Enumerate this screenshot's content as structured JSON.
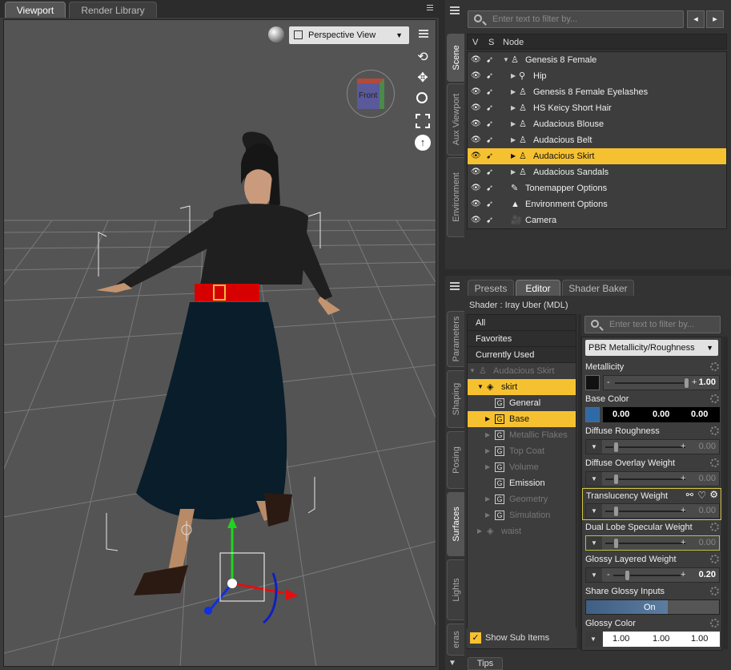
{
  "tabs": {
    "viewport": "Viewport",
    "render_library": "Render Library"
  },
  "viewport": {
    "camera": "Perspective View",
    "cube_label": "Front"
  },
  "scene": {
    "filter_placeholder": "Enter text to filter by...",
    "col_v": "V",
    "col_s": "S",
    "col_node": "Node",
    "nodes": [
      {
        "label": "Genesis 8 Female"
      },
      {
        "label": "Hip"
      },
      {
        "label": "Genesis 8 Female Eyelashes"
      },
      {
        "label": "HS Keicy Short Hair"
      },
      {
        "label": "Audacious Blouse"
      },
      {
        "label": "Audacious Belt"
      },
      {
        "label": "Audacious Skirt"
      },
      {
        "label": "Audacious Sandals"
      },
      {
        "label": "Tonemapper Options"
      },
      {
        "label": "Environment Options"
      },
      {
        "label": "Camera"
      }
    ]
  },
  "side_tabs_top": {
    "scene": "Scene",
    "aux": "Aux Viewport",
    "env": "Environment"
  },
  "side_tabs_bottom": {
    "parameters": "Parameters",
    "shaping": "Shaping",
    "posing": "Posing",
    "surfaces": "Surfaces",
    "lights": "Lights",
    "cameras": "eras"
  },
  "surfaces": {
    "tab_presets": "Presets",
    "tab_editor": "Editor",
    "tab_shader": "Shader Baker",
    "shader": "Shader : Iray Uber (MDL)",
    "filter_placeholder": "Enter text to filter by...",
    "mode": "PBR Metallicity/Roughness",
    "tree": [
      {
        "label": "All"
      },
      {
        "label": "Favorites"
      },
      {
        "label": "Currently Used"
      },
      {
        "label": "Audacious Skirt"
      },
      {
        "label": "skirt"
      },
      {
        "label": "General"
      },
      {
        "label": "Base"
      },
      {
        "label": "Metallic Flakes"
      },
      {
        "label": "Top Coat"
      },
      {
        "label": "Volume"
      },
      {
        "label": "Emission"
      },
      {
        "label": "Geometry"
      },
      {
        "label": "Simulation"
      },
      {
        "label": "waist"
      }
    ],
    "show_sub": "Show Sub Items",
    "props": {
      "metallicity": {
        "label": "Metallicity",
        "value": "1.00"
      },
      "base_color": {
        "label": "Base Color",
        "r": "0.00",
        "g": "0.00",
        "b": "0.00"
      },
      "diffuse_roughness": {
        "label": "Diffuse Roughness",
        "value": "0.00"
      },
      "diffuse_overlay": {
        "label": "Diffuse Overlay Weight",
        "value": "0.00"
      },
      "translucency": {
        "label": "Translucency Weight",
        "value": "0.00"
      },
      "dual_lobe": {
        "label": "Dual Lobe Specular Weight",
        "value": "0.00"
      },
      "glossy_layered": {
        "label": "Glossy Layered Weight",
        "value": "0.20"
      },
      "share_glossy": {
        "label": "Share Glossy Inputs",
        "value": "On"
      },
      "glossy_color": {
        "label": "Glossy Color",
        "r": "1.00",
        "g": "1.00",
        "b": "1.00"
      }
    }
  },
  "tips": "Tips",
  "colors": {
    "selection": "#f6c131",
    "panel": "#3d3d3d",
    "viewport": "#545454"
  }
}
